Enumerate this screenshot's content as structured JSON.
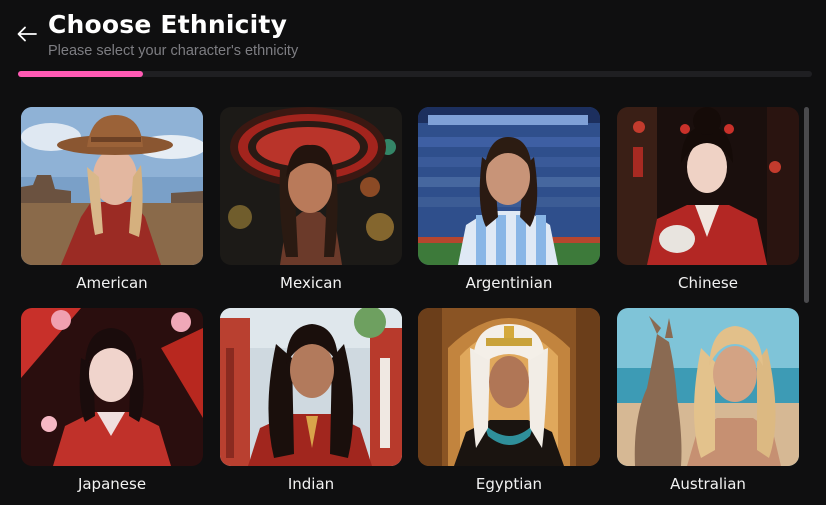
{
  "header": {
    "title": "Choose Ethnicity",
    "subtitle": "Please select your character's ethnicity"
  },
  "progress": {
    "fraction": 0.157,
    "color": "#ff5ab4"
  },
  "options": [
    {
      "label": "American"
    },
    {
      "label": "Mexican"
    },
    {
      "label": "Argentinian"
    },
    {
      "label": "Chinese"
    },
    {
      "label": "Japanese"
    },
    {
      "label": "Indian"
    },
    {
      "label": "Egyptian"
    },
    {
      "label": "Australian"
    }
  ]
}
